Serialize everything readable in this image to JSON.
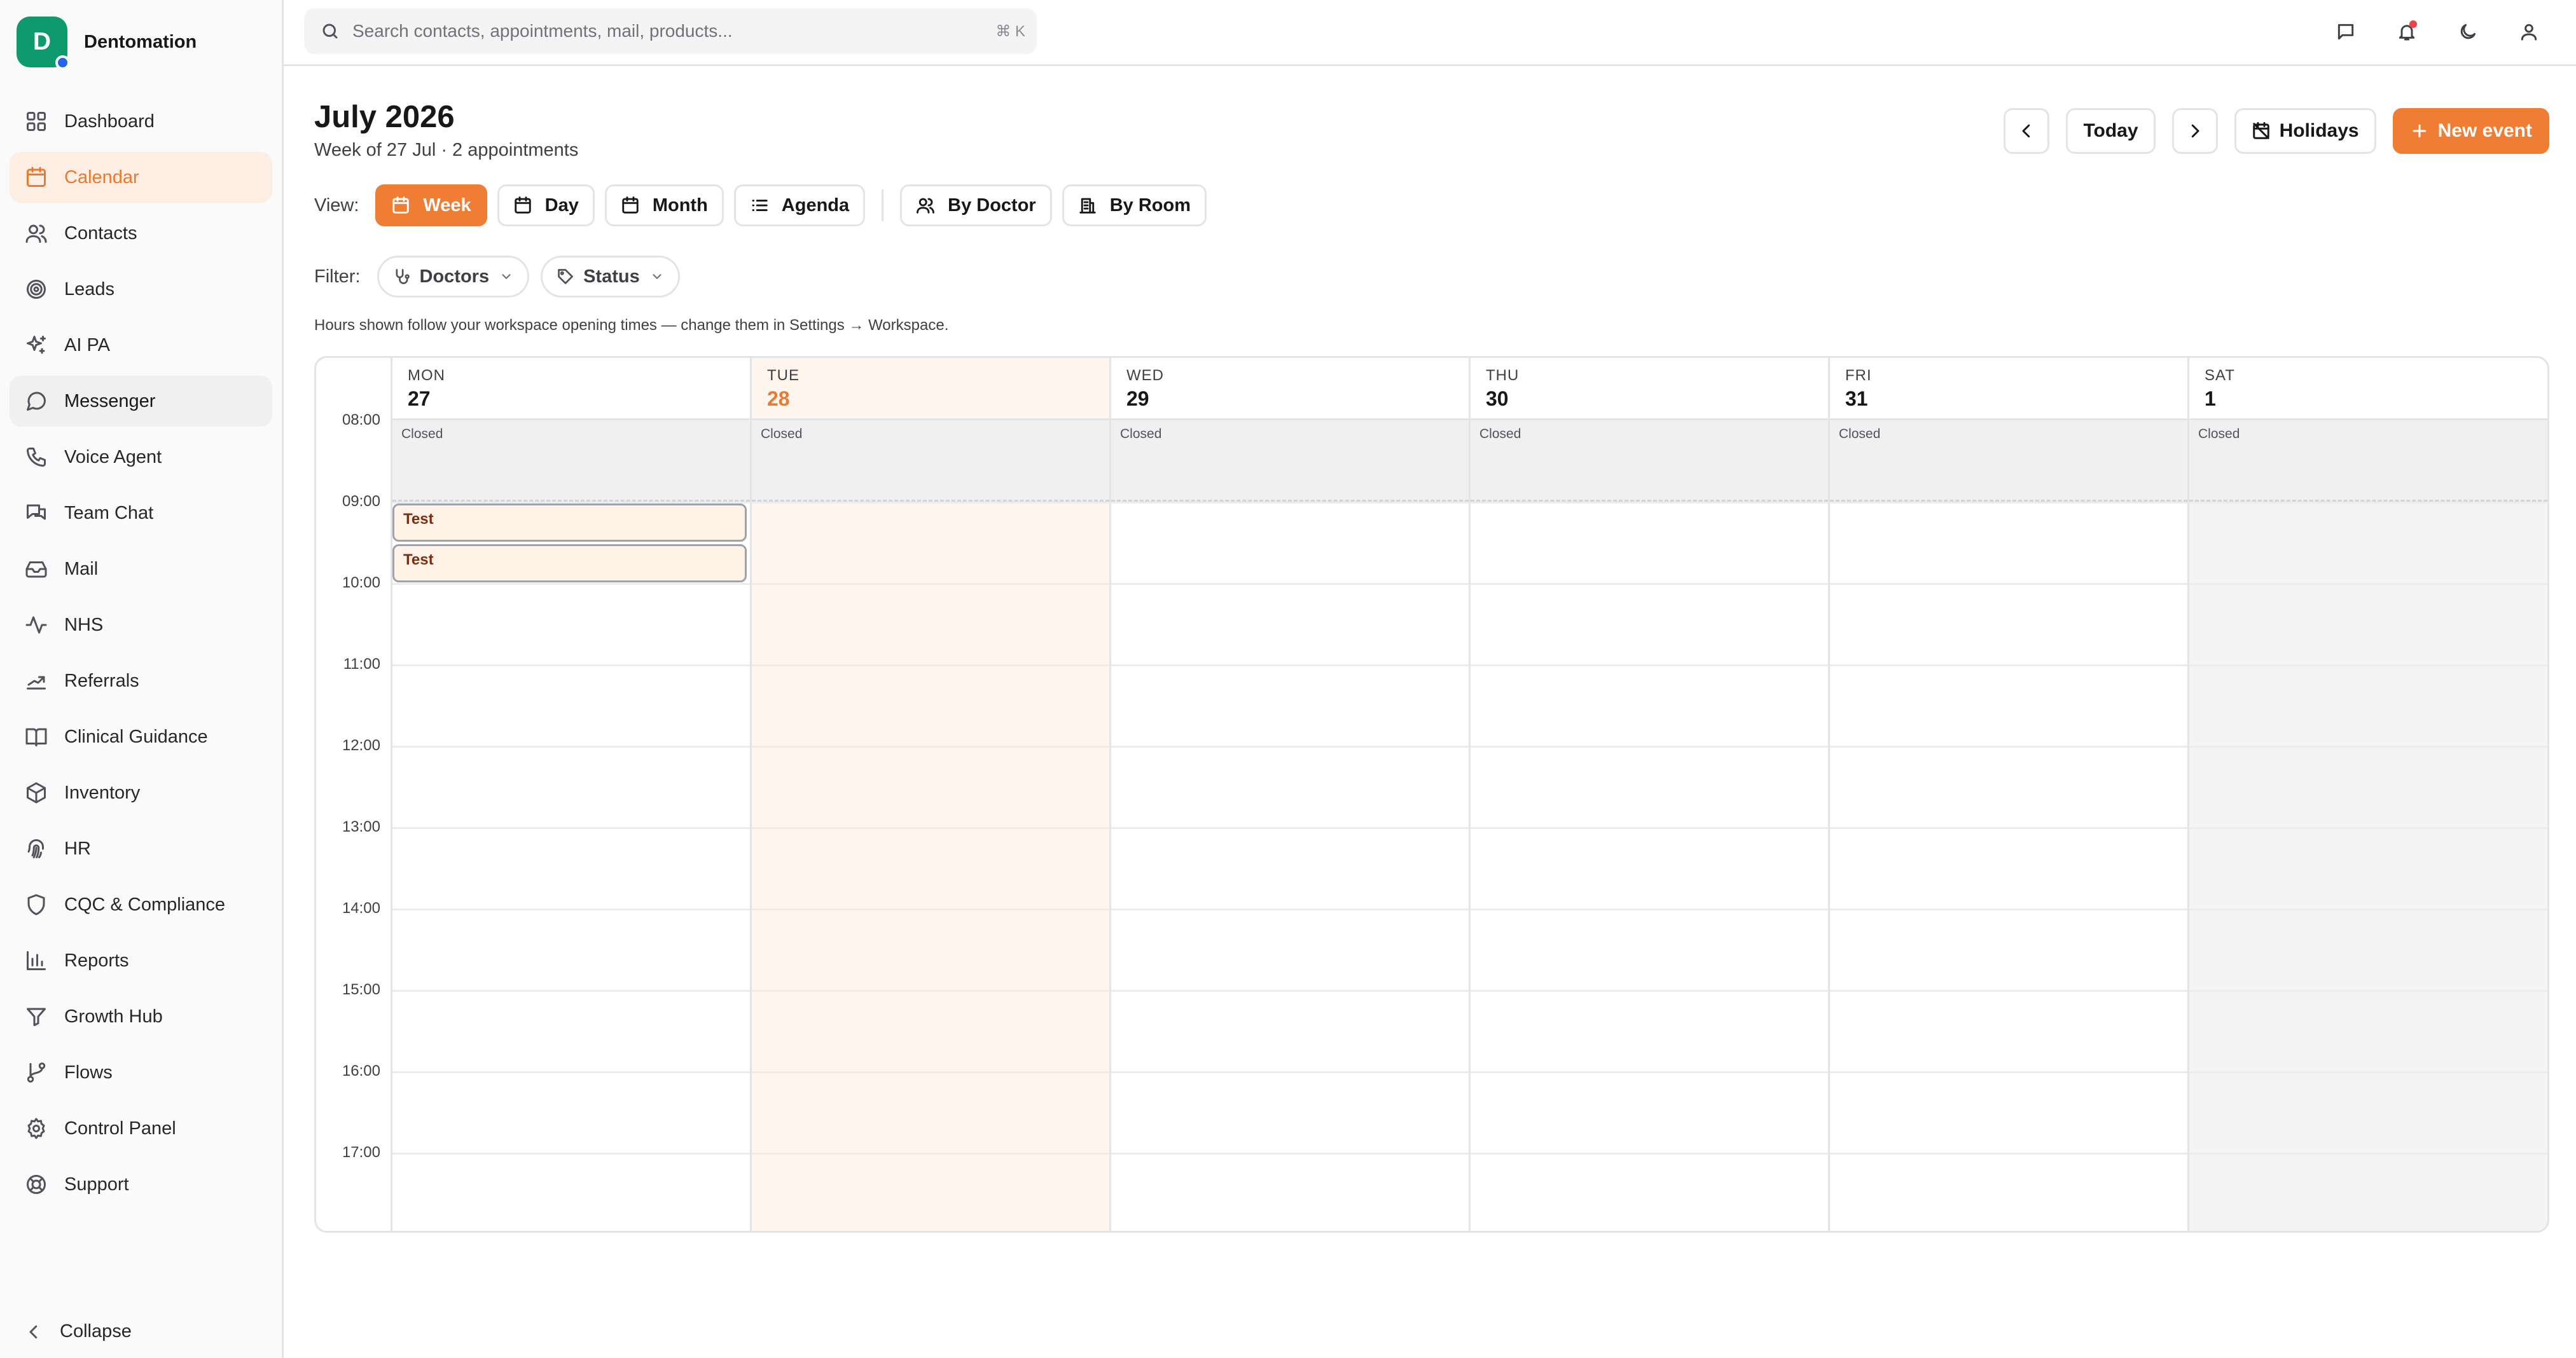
{
  "app": {
    "name": "Dentomation",
    "logo_letter": "D"
  },
  "sidebar": {
    "items": [
      {
        "label": "Dashboard",
        "icon": "dashboard-icon",
        "state": "normal"
      },
      {
        "label": "Calendar",
        "icon": "calendar-icon",
        "state": "active"
      },
      {
        "label": "Contacts",
        "icon": "contacts-icon",
        "state": "normal"
      },
      {
        "label": "Leads",
        "icon": "target-icon",
        "state": "normal"
      },
      {
        "label": "AI PA",
        "icon": "sparkles-icon",
        "state": "normal"
      },
      {
        "label": "Messenger",
        "icon": "message-circle-icon",
        "state": "hover"
      },
      {
        "label": "Voice Agent",
        "icon": "phone-icon",
        "state": "normal"
      },
      {
        "label": "Team Chat",
        "icon": "chat-bubbles-icon",
        "state": "normal"
      },
      {
        "label": "Mail",
        "icon": "inbox-icon",
        "state": "normal"
      },
      {
        "label": "NHS",
        "icon": "activity-icon",
        "state": "normal"
      },
      {
        "label": "Referrals",
        "icon": "referral-icon",
        "state": "normal"
      },
      {
        "label": "Clinical Guidance",
        "icon": "book-icon",
        "state": "normal"
      },
      {
        "label": "Inventory",
        "icon": "package-icon",
        "state": "normal"
      },
      {
        "label": "HR",
        "icon": "fingerprint-icon",
        "state": "normal"
      },
      {
        "label": "CQC & Compliance",
        "icon": "shield-icon",
        "state": "normal"
      },
      {
        "label": "Reports",
        "icon": "bar-chart-icon",
        "state": "normal"
      },
      {
        "label": "Growth Hub",
        "icon": "funnel-icon",
        "state": "normal"
      },
      {
        "label": "Flows",
        "icon": "git-branch-icon",
        "state": "normal"
      },
      {
        "label": "Control Panel",
        "icon": "gear-icon",
        "state": "normal"
      },
      {
        "label": "Support",
        "icon": "lifebuoy-icon",
        "state": "normal"
      }
    ],
    "collapse_label": "Collapse"
  },
  "topbar": {
    "search_placeholder": "Search contacts, appointments, mail, products...",
    "shortcut": "⌘ K",
    "icons": [
      "message-square-icon",
      "bell-icon",
      "moon-icon",
      "user-icon"
    ],
    "notification_dot_color": "#ef4444"
  },
  "header": {
    "title": "July 2026",
    "subtitle": "Week of 27 Jul · 2 appointments",
    "today_label": "Today",
    "holidays_label": "Holidays",
    "new_event_label": "New event"
  },
  "views": {
    "label": "View:",
    "options": [
      {
        "label": "Week",
        "icon": "calendar-icon",
        "active": true
      },
      {
        "label": "Day",
        "icon": "calendar-icon",
        "active": false
      },
      {
        "label": "Month",
        "icon": "calendar-icon",
        "active": false
      },
      {
        "label": "Agenda",
        "icon": "list-icon",
        "active": false
      }
    ],
    "groupings": [
      {
        "label": "By Doctor",
        "icon": "users-icon"
      },
      {
        "label": "By Room",
        "icon": "building-icon"
      }
    ]
  },
  "filters": {
    "label": "Filter:",
    "options": [
      {
        "label": "Doctors",
        "icon": "stethoscope-icon"
      },
      {
        "label": "Status",
        "icon": "tag-icon"
      }
    ]
  },
  "hint": "Hours shown follow your workspace opening times — change them in Settings → Workspace.",
  "calendar": {
    "times": [
      "08:00",
      "09:00",
      "10:00",
      "11:00",
      "12:00",
      "13:00",
      "14:00",
      "15:00",
      "16:00",
      "17:00"
    ],
    "closed_label": "Closed",
    "days": [
      {
        "name": "MON",
        "num": "27",
        "today": false,
        "weekend": false
      },
      {
        "name": "TUE",
        "num": "28",
        "today": true,
        "weekend": false
      },
      {
        "name": "WED",
        "num": "29",
        "today": false,
        "weekend": false
      },
      {
        "name": "THU",
        "num": "30",
        "today": false,
        "weekend": false
      },
      {
        "name": "FRI",
        "num": "31",
        "today": false,
        "weekend": false
      },
      {
        "name": "SAT",
        "num": "1",
        "today": false,
        "weekend": true
      }
    ],
    "events": [
      {
        "title": "Test",
        "day": "MON",
        "slot": "09:00"
      },
      {
        "title": "Test",
        "day": "MON",
        "slot": "09:30"
      }
    ]
  },
  "colors": {
    "accent": "#ef7d33",
    "accent_text": "#ea7a32",
    "active_nav_bg": "#fdeee3",
    "today_bg": "#fef6ec",
    "closed_bg": "#f0f0f1",
    "logo_bg": "#0e9a6c"
  }
}
